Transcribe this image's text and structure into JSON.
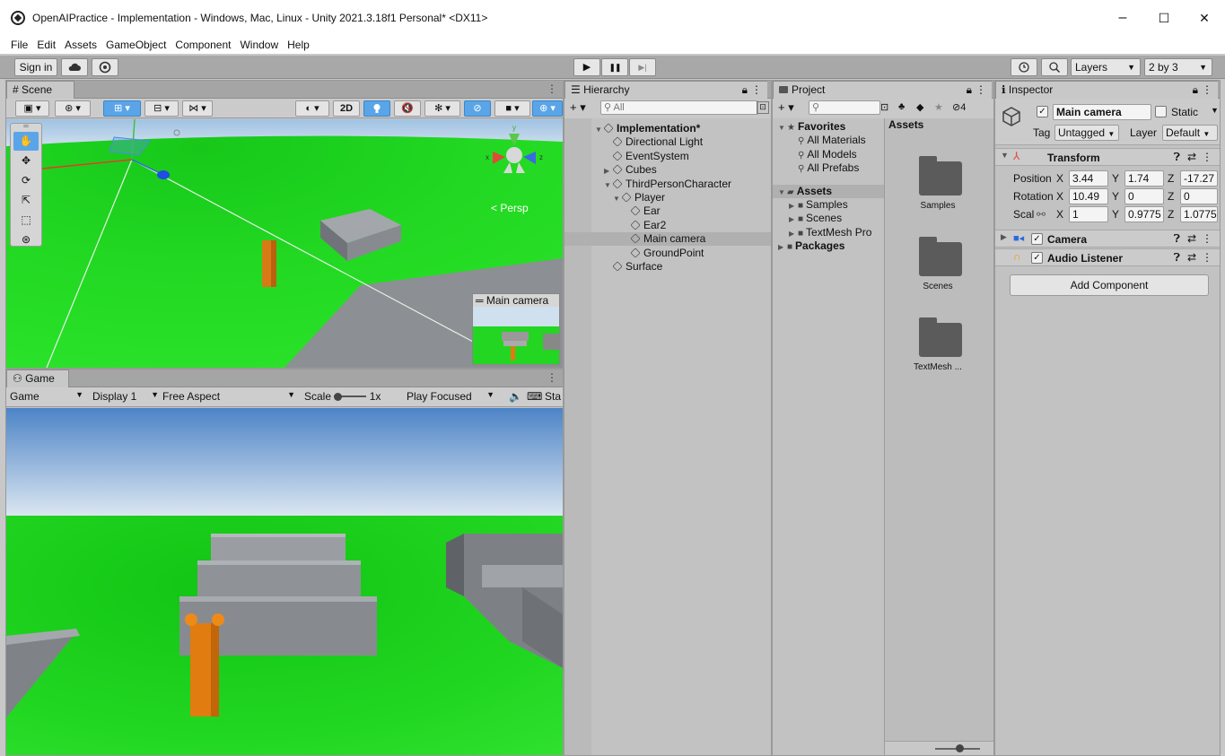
{
  "window": {
    "title": "OpenAIPractice - Implementation - Windows, Mac, Linux - Unity 2021.3.18f1 Personal* <DX11>",
    "minimize": "–",
    "maximize": "☐",
    "close": "✕"
  },
  "menu": [
    "File",
    "Edit",
    "Assets",
    "GameObject",
    "Component",
    "Window",
    "Help"
  ],
  "toolbar": {
    "sign_in": "Sign in",
    "play": "▶",
    "pause": "❚❚",
    "step": "▶|",
    "layers": "Layers",
    "layout": "2 by 3"
  },
  "scene": {
    "tab": "Scene",
    "btn_2d": "2D",
    "persp": "< Persp",
    "camera_preview_title": "Main camera"
  },
  "game": {
    "tab": "Game",
    "mode": "Game",
    "display": "Display 1",
    "aspect": "Free Aspect",
    "scale_label": "Scale",
    "scale_value": "1x",
    "play_mode": "Play Focused",
    "stats": "Sta"
  },
  "hierarchy": {
    "tab": "Hierarchy",
    "search_placeholder": "All",
    "items": [
      {
        "label": "Implementation*",
        "depth": 0,
        "bold": true,
        "arrow": "▼",
        "icon": "unity-scene-icon"
      },
      {
        "label": "Directional Light",
        "depth": 1
      },
      {
        "label": "EventSystem",
        "depth": 1
      },
      {
        "label": "Cubes",
        "depth": 1,
        "arrow": "▶"
      },
      {
        "label": "ThirdPersonCharacter",
        "depth": 1,
        "arrow": "▼"
      },
      {
        "label": "Player",
        "depth": 2,
        "arrow": "▼"
      },
      {
        "label": "Ear",
        "depth": 3
      },
      {
        "label": "Ear2",
        "depth": 3
      },
      {
        "label": "Main camera",
        "depth": 3,
        "selected": true
      },
      {
        "label": "GroundPoint",
        "depth": 3
      },
      {
        "label": "Surface",
        "depth": 1
      }
    ]
  },
  "project": {
    "tab": "Project",
    "hidden_count": "4",
    "tree": [
      {
        "label": "Favorites",
        "bold": true,
        "arrow": "▼",
        "icon": "star",
        "depth": 0
      },
      {
        "label": "All Materials",
        "depth": 1,
        "icon": "search"
      },
      {
        "label": "All Models",
        "depth": 1,
        "icon": "search"
      },
      {
        "label": "All Prefabs",
        "depth": 1,
        "icon": "search"
      },
      {
        "label": "Assets",
        "bold": true,
        "arrow": "▼",
        "icon": "folder-open",
        "depth": 0,
        "selected": true
      },
      {
        "label": "Samples",
        "depth": 1,
        "arrow": "▶",
        "icon": "folder"
      },
      {
        "label": "Scenes",
        "depth": 1,
        "arrow": "▶",
        "icon": "folder"
      },
      {
        "label": "TextMesh Pro",
        "depth": 1,
        "arrow": "▶",
        "icon": "folder"
      },
      {
        "label": "Packages",
        "bold": true,
        "arrow": "▶",
        "icon": "folder",
        "depth": 0
      }
    ],
    "assets_header": "Assets",
    "folders": [
      "Samples",
      "Scenes",
      "TextMesh ..."
    ]
  },
  "inspector": {
    "tab": "Inspector",
    "object_name": "Main camera",
    "static_label": "Static",
    "tag_label": "Tag",
    "tag_value": "Untagged",
    "layer_label": "Layer",
    "layer_value": "Default",
    "transform": {
      "title": "Transform",
      "position_label": "Position",
      "rotation_label": "Rotation",
      "scale_label": "Scal",
      "position": {
        "x": "3.44",
        "y": "1.74",
        "z": "-17.27"
      },
      "rotation": {
        "x": "10.49",
        "y": "0",
        "z": "0"
      },
      "scale": {
        "x": "1",
        "y": "0.9775",
        "z": "1.0775"
      }
    },
    "camera_title": "Camera",
    "audio_title": "Audio Listener",
    "add_component": "Add Component"
  },
  "colors": {
    "ground": "#1fd31f",
    "sky_top": "#4f86c9",
    "sky_bottom": "#d8e6f2",
    "character": "#e07b12",
    "platform": "#8f949a",
    "selection": "#3c82cf"
  }
}
